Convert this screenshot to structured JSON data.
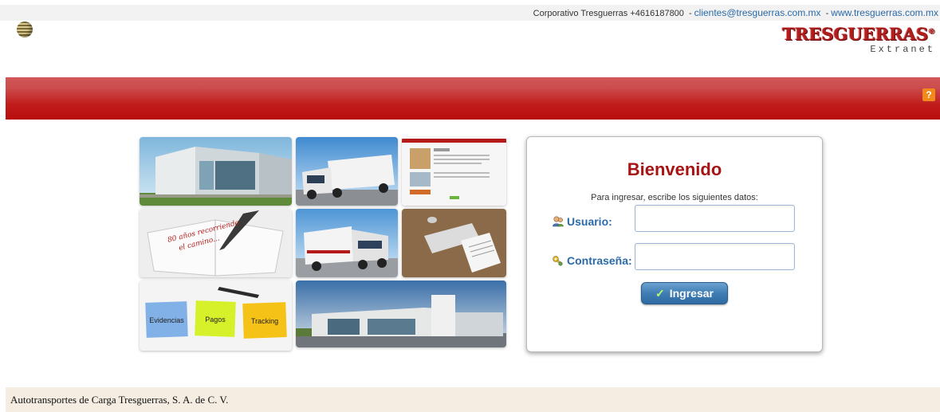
{
  "header": {
    "contact_prefix": "Corporativo Tresguerras +4616187800",
    "email": "clientes@tresguerras.com.mx",
    "website": "www.tresguerras.com.mx",
    "separator": "-"
  },
  "brand": {
    "name": "TRESGUERRAS",
    "registered": "®",
    "subtitle": "Extranet"
  },
  "help": {
    "label": "?"
  },
  "mosaic": {
    "notebook_text_line1": "80 años recorriendo",
    "notebook_text_line2": "el camino...",
    "note_evidencias": "Evidencias",
    "note_pagos": "Pagos",
    "note_tracking": "Tracking"
  },
  "login": {
    "title": "Bienvenido",
    "instructions": "Para ingresar, escribe los siguientes datos:",
    "user_label": "Usuario:",
    "user_value": "",
    "pass_label": "Contraseña:",
    "pass_value": "",
    "submit_label": "Ingresar"
  },
  "footer": {
    "text": "Autotransportes de Carga Tresguerras, S. A. de C. V."
  },
  "colors": {
    "brand_red": "#b01e1e",
    "band_red": "#c01b1b",
    "link_blue": "#2a6aa8",
    "button_blue": "#3f7db4",
    "help_orange": "#f08a1a",
    "footer_bg": "#f5ede2"
  }
}
